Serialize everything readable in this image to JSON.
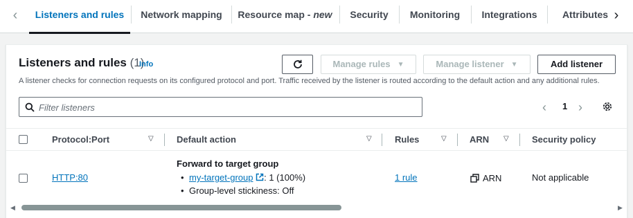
{
  "tabs": [
    {
      "label": "Listeners and rules",
      "active": true
    },
    {
      "label": "Network mapping"
    },
    {
      "label": "Resource map - ",
      "suffix": "new"
    },
    {
      "label": "Security"
    },
    {
      "label": "Monitoring"
    },
    {
      "label": "Integrations"
    },
    {
      "label": "Attributes"
    }
  ],
  "header": {
    "title": "Listeners and rules",
    "count": "(1)",
    "info": "Info",
    "description": "A listener checks for connection requests on its configured protocol and port. Traffic received by the listener is routed according to the default action and any additional rules."
  },
  "actions": {
    "manage_rules": "Manage rules",
    "manage_listener": "Manage listener",
    "add_listener": "Add listener"
  },
  "filter": {
    "placeholder": "Filter listeners",
    "value": ""
  },
  "pagination": {
    "current_page": "1"
  },
  "table": {
    "columns": [
      "Protocol:Port",
      "Default action",
      "Rules",
      "ARN",
      "Security policy"
    ],
    "rows": [
      {
        "protocol_port": "HTTP:80",
        "default_action_title": "Forward to target group",
        "target_group": "my-target-group",
        "target_weight": ": 1 (100%)",
        "stickiness": "Group-level stickiness: Off",
        "rules": "1 rule",
        "arn": "ARN",
        "security_policy": "Not applicable"
      }
    ]
  },
  "colors": {
    "link": "#0073bb",
    "text": "#16191f",
    "border": "#d5dbdb"
  }
}
